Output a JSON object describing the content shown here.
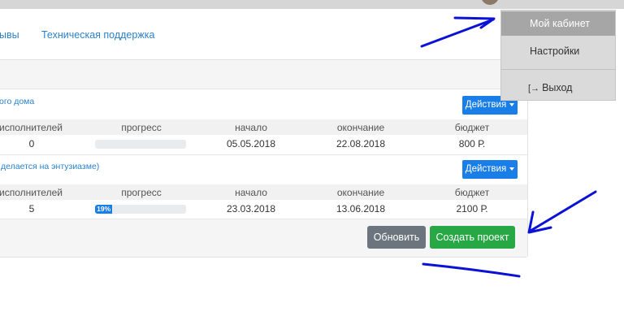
{
  "nav": {
    "links": [
      {
        "label": "ывы"
      },
      {
        "label": "Техническая поддержка"
      }
    ]
  },
  "user_menu": {
    "items": [
      {
        "label": "Мой кабинет",
        "active": true
      },
      {
        "label": "Настройки"
      },
      {
        "label": "Выход",
        "icon": "logout-icon"
      }
    ]
  },
  "table": {
    "columns": [
      "исполнителей",
      "прогресс",
      "начало",
      "окончание",
      "бюджет"
    ],
    "projects": [
      {
        "title": "ого дома",
        "action_label": "Действия",
        "executors": "0",
        "progress": 0,
        "progress_label": "",
        "start": "05.05.2018",
        "end": "22.08.2018",
        "budget": "800 Р."
      },
      {
        "title": "делается на энтузиазме)",
        "action_label": "Действия",
        "executors": "5",
        "progress": 19,
        "progress_label": "19%",
        "start": "23.03.2018",
        "end": "13.06.2018",
        "budget": "2100 Р."
      }
    ]
  },
  "footer": {
    "refresh_label": "Обновить",
    "create_label": "Создать проект"
  },
  "colors": {
    "link": "#2b82c9",
    "primary": "#1a7ee8",
    "refresh": "#6c757d",
    "create": "#28a745",
    "annotation": "#0a12d6"
  }
}
